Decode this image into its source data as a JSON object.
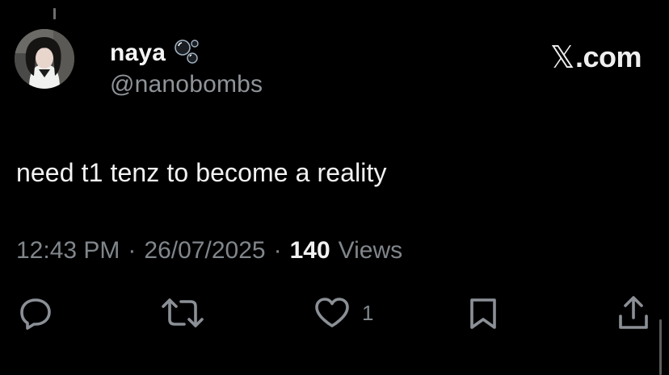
{
  "tweet": {
    "author": {
      "display_name": "naya",
      "handle": "@nanobombs",
      "avatar_icon": "profile-photo",
      "name_emoji_icon": "bubbles-icon"
    },
    "brand": {
      "label": ".com",
      "mark": "𝕏"
    },
    "text": "need t1 tenz to become a reality",
    "meta": {
      "time": "12:43 PM",
      "separator": "·",
      "date": "26/07/2025",
      "views_count": "140",
      "views_label": "Views"
    },
    "actions": {
      "reply_icon": "reply-icon",
      "retweet_icon": "retweet-icon",
      "like_icon": "heart-icon",
      "like_count": "1",
      "bookmark_icon": "bookmark-icon",
      "share_icon": "share-icon"
    }
  },
  "colors": {
    "background": "#000000",
    "primary_text": "#e7e9ea",
    "secondary_text": "#80868b"
  }
}
